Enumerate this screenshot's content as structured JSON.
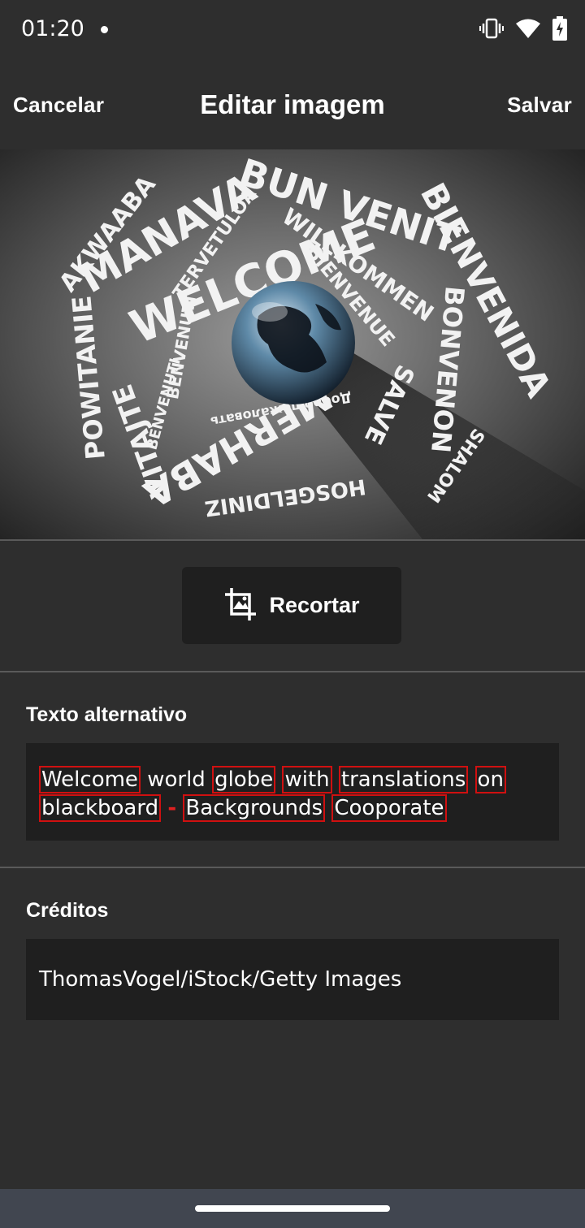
{
  "status_bar": {
    "time": "01:20",
    "icons": [
      "vibrate-icon",
      "wifi-icon",
      "battery-charging-icon"
    ]
  },
  "app_bar": {
    "cancel_label": "Cancelar",
    "title": "Editar imagem",
    "save_label": "Salvar"
  },
  "image": {
    "words": [
      "WELCOME",
      "MANAVA",
      "BUN VENIT",
      "BIENVENIDA",
      "WILLKOMMEN",
      "BIENVENUE",
      "AKWAABA",
      "TERVETULOA",
      "BENVENUTI",
      "BENVENUTI",
      "POWITANIE",
      "VITAJTE",
      "MERHABA",
      "HOSGELDINIZ",
      "SALVE",
      "BONVENON",
      "SHALOM",
      "Добро пожаловать"
    ]
  },
  "crop": {
    "label": "Recortar",
    "icon": "crop-icon"
  },
  "alt_text": {
    "label": "Texto alternativo",
    "words": [
      "Welcome",
      "world",
      "globe",
      "with",
      "translations",
      "on",
      "blackboard",
      "-",
      "Backgrounds",
      "Cooporate"
    ]
  },
  "credits": {
    "label": "Créditos",
    "value": "ThomasVogel/iStock/Getty Images"
  },
  "colors": {
    "background": "#2e2e2e",
    "field": "#1f1f1f",
    "spellcheck_underline": "#d01010",
    "nav_bar": "#414650"
  }
}
